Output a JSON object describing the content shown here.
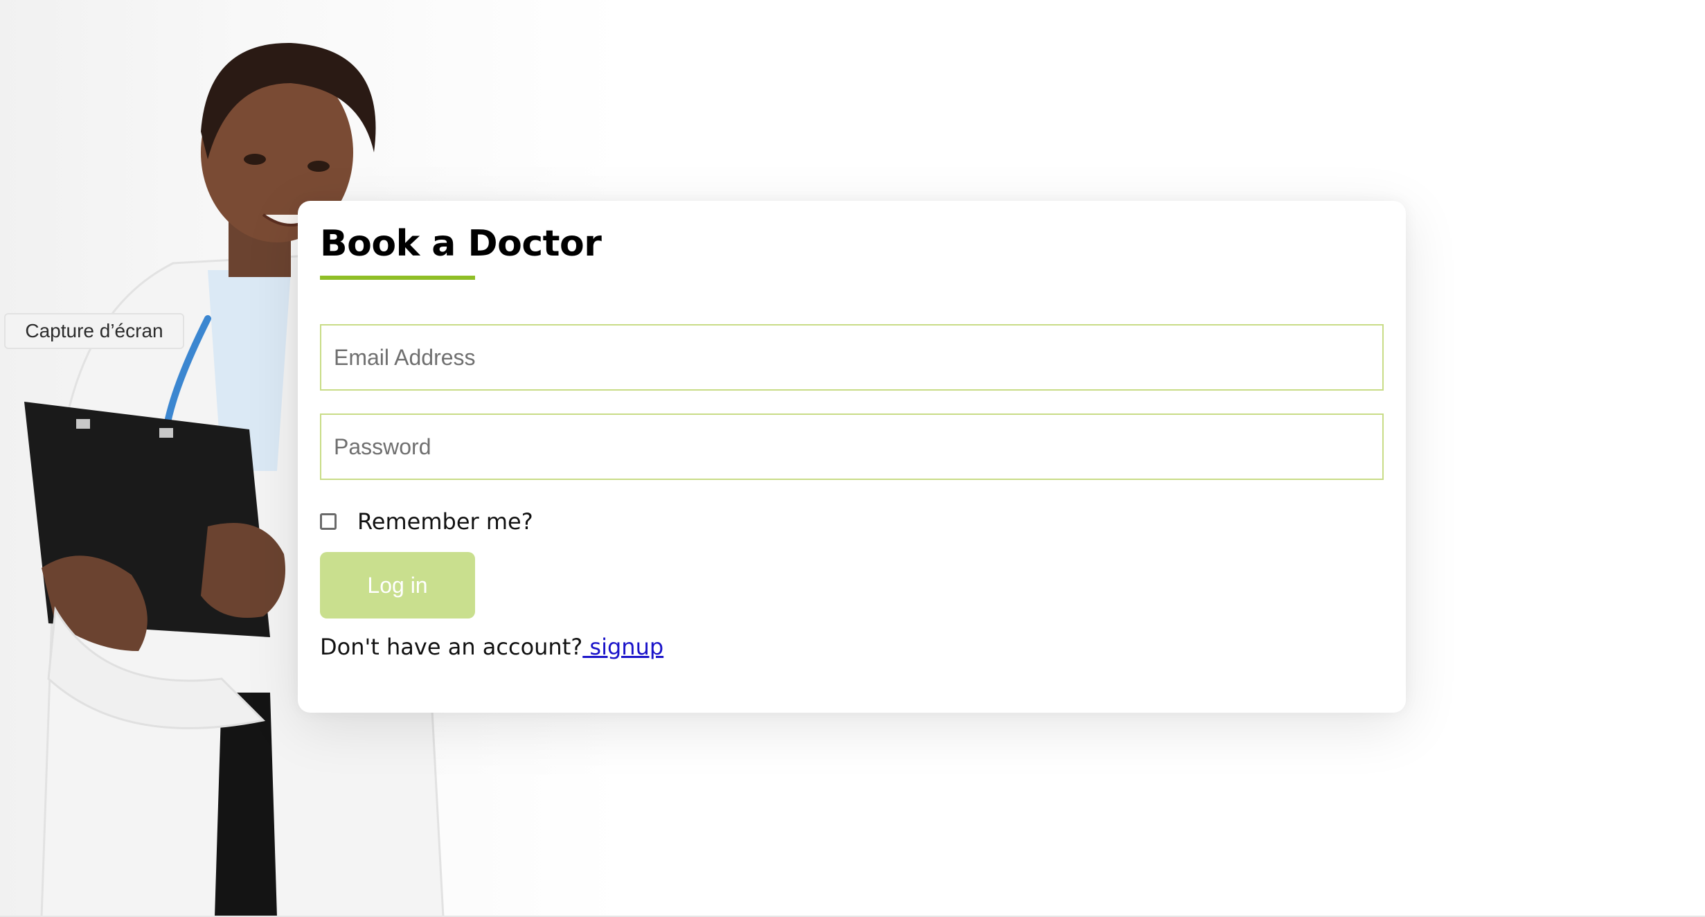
{
  "overlay": {
    "screenshot_label": "Capture d’écran"
  },
  "card": {
    "title": "Book a Doctor",
    "email_placeholder": "Email Address",
    "password_placeholder": "Password",
    "remember_label": "Remember me?",
    "login_label": "Log in",
    "signup_prompt": "Don't have an account?",
    "signup_link": " signup"
  },
  "colors": {
    "accent": "#8fbe26",
    "button_bg": "#c9df8e",
    "input_border": "#c8dc86",
    "link": "#1a13c9"
  },
  "icons": {
    "background": "doctor-photo",
    "checkbox": "checkbox-unchecked-icon"
  }
}
